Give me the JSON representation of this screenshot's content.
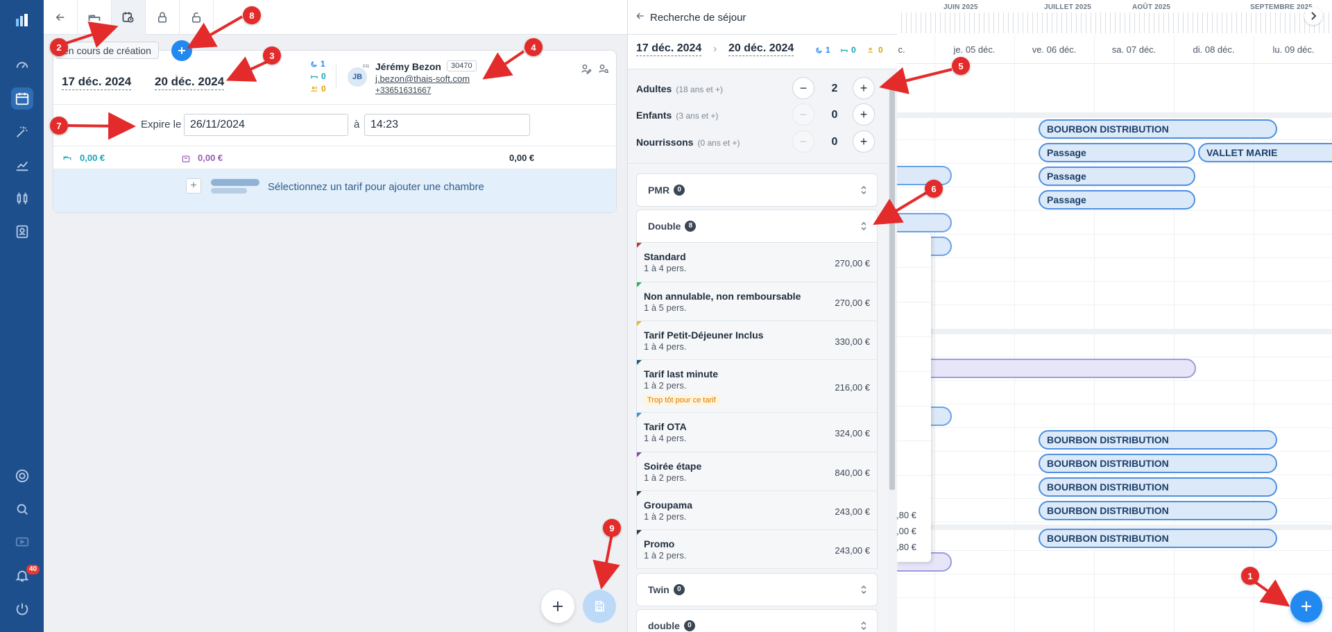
{
  "sidebar": {
    "notifications_count": "40"
  },
  "card": {
    "status": "en cours de création",
    "arrival": "17 déc. 2024",
    "departure": "20 déc. 2024",
    "nights": "1",
    "rooms": "0",
    "persons": "0",
    "customer_initials": "JB",
    "customer_lang": "FR",
    "customer_name": "Jérémy Bezon",
    "customer_id": "30470",
    "customer_email": "j.bezon@thais-soft.com",
    "customer_phone": "+33651631667",
    "expire_label": "Expire le",
    "expire_date": "26/11/2024",
    "expire_at": "à",
    "expire_time": "14:23",
    "rooms_total": "0,00 €",
    "products_total": "0,00 €",
    "grand_total": "0,00 €",
    "select_rate_text": "Sélectionnez un tarif pour ajouter une chambre"
  },
  "panel": {
    "title": "Recherche de séjour",
    "arrival": "17 déc. 2024",
    "departure": "20 déc. 2024",
    "nights": "1",
    "rooms": "0",
    "persons": "0",
    "adults_label": "Adultes",
    "adults_sub": "(18 ans et +)",
    "adults_value": "2",
    "children_label": "Enfants",
    "children_sub": "(3 ans et +)",
    "children_value": "0",
    "infants_label": "Nourrissons",
    "infants_sub": "(0 ans et +)",
    "infants_value": "0",
    "categories": [
      {
        "name": "PMR",
        "count": "0"
      },
      {
        "name": "Double",
        "count": "8"
      },
      {
        "name": "Twin",
        "count": "0"
      },
      {
        "name": "double",
        "count": "0"
      }
    ],
    "rates": [
      {
        "name": "Standard",
        "persons": "1 à 4 pers.",
        "price": "270,00 €",
        "color": "#c0392b"
      },
      {
        "name": "Non annulable, non remboursable",
        "persons": "1 à 5 pers.",
        "price": "270,00 €",
        "color": "#27ae60"
      },
      {
        "name": "Tarif Petit-Déjeuner Inclus",
        "persons": "1 à 4 pers.",
        "price": "330,00 €",
        "color": "#f0b429"
      },
      {
        "name": "Tarif last minute",
        "persons": "1 à 2 pers.",
        "price": "216,00 €",
        "color": "#1a5f7a",
        "warning": "Trop tôt pour ce tarif"
      },
      {
        "name": "Tarif OTA",
        "persons": "1 à 4 pers.",
        "price": "324,00 €",
        "color": "#3498db"
      },
      {
        "name": "Soirée étape",
        "persons": "1 à 2 pers.",
        "price": "840,00 €",
        "color": "#8e44ad"
      },
      {
        "name": "Groupama",
        "persons": "1 à 2 pers.",
        "price": "243,00 €",
        "color": "#2c3e50"
      },
      {
        "name": "Promo",
        "persons": "1 à 2 pers.",
        "price": "243,00 €",
        "color": "#2c3e50"
      }
    ]
  },
  "planning": {
    "months": [
      "JUIN 2025",
      "JUILLET 2025",
      "AOÛT 2025",
      "SEPTEMBRE 2025"
    ],
    "days": [
      "c.",
      "je. 05 déc.",
      "ve. 06 déc.",
      "sa. 07 déc.",
      "di. 08 déc.",
      "lu. 09 déc."
    ],
    "bars": [
      "BOURBON DISTRIBUTION",
      "Passage",
      "VALLET MARIE",
      "Passage",
      "Passage",
      "BOURBON DISTRIBUTION",
      "BOURBON DISTRIBUTION",
      "BOURBON DISTRIBUTION",
      "BOURBON DISTRIBUTION",
      "BOURBON DISTRIBUTION"
    ],
    "price_fragments": [
      ",80 €",
      ",00 €",
      ",80 €"
    ]
  },
  "annotations": [
    "1",
    "2",
    "3",
    "4",
    "5",
    "6",
    "7",
    "8",
    "9"
  ],
  "colors": {
    "sidebar": "#1d4f8c",
    "accent": "#2189f0",
    "annotation": "#e32b2b",
    "bar_border": "#4d8fe0"
  }
}
